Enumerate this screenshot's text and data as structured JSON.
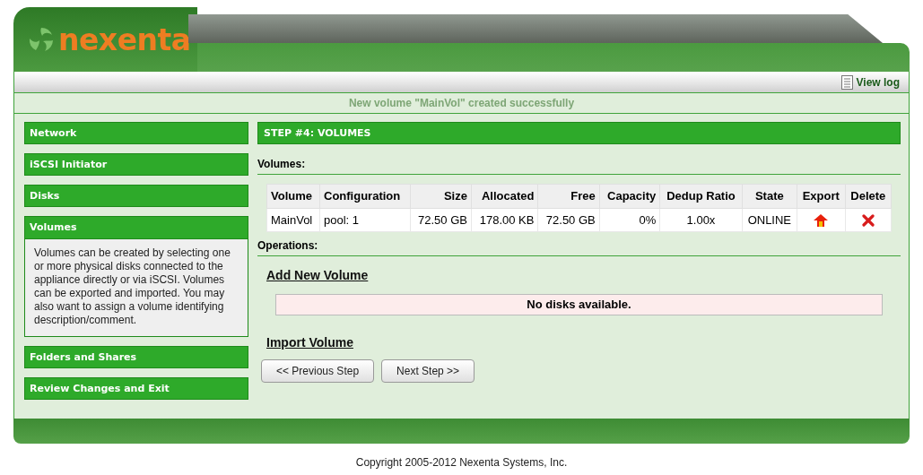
{
  "header": {
    "logo_text": "nexenta",
    "view_log": "View log"
  },
  "message": "New volume \"MainVol\" created successfully",
  "sidebar": {
    "items": [
      {
        "label": "Network",
        "expanded": false
      },
      {
        "label": "iSCSI Initiator",
        "expanded": false
      },
      {
        "label": "Disks",
        "expanded": false
      },
      {
        "label": "Volumes",
        "expanded": true,
        "description": "Volumes can be created by selecting one or more physical disks connected to the appliance directly or via iSCSI. Volumes can be exported and imported. You may also want to assign a volume identifying description/comment."
      },
      {
        "label": "Folders and Shares",
        "expanded": false
      },
      {
        "label": "Review Changes and Exit",
        "expanded": false
      }
    ]
  },
  "step_title": "STEP #4: VOLUMES",
  "volumes_label": "Volumes:",
  "table": {
    "columns": [
      "Volume",
      "Configuration",
      "Size",
      "Allocated",
      "Free",
      "Capacity",
      "Dedup Ratio",
      "State",
      "Export",
      "Delete"
    ],
    "rows": [
      {
        "cells": [
          "MainVol",
          "pool: 1",
          "72.50 GB",
          "178.00 KB",
          "72.50 GB",
          "0%",
          "1.00x",
          "ONLINE"
        ]
      }
    ]
  },
  "operations_label": "Operations:",
  "add_volume": {
    "title": "Add New Volume",
    "notice": "No disks available."
  },
  "import_volume": {
    "title": "Import Volume"
  },
  "buttons": [
    "<< Previous Step",
    "Next Step >>"
  ],
  "footer": "Copyright 2005-2012 Nexenta Systems, Inc."
}
